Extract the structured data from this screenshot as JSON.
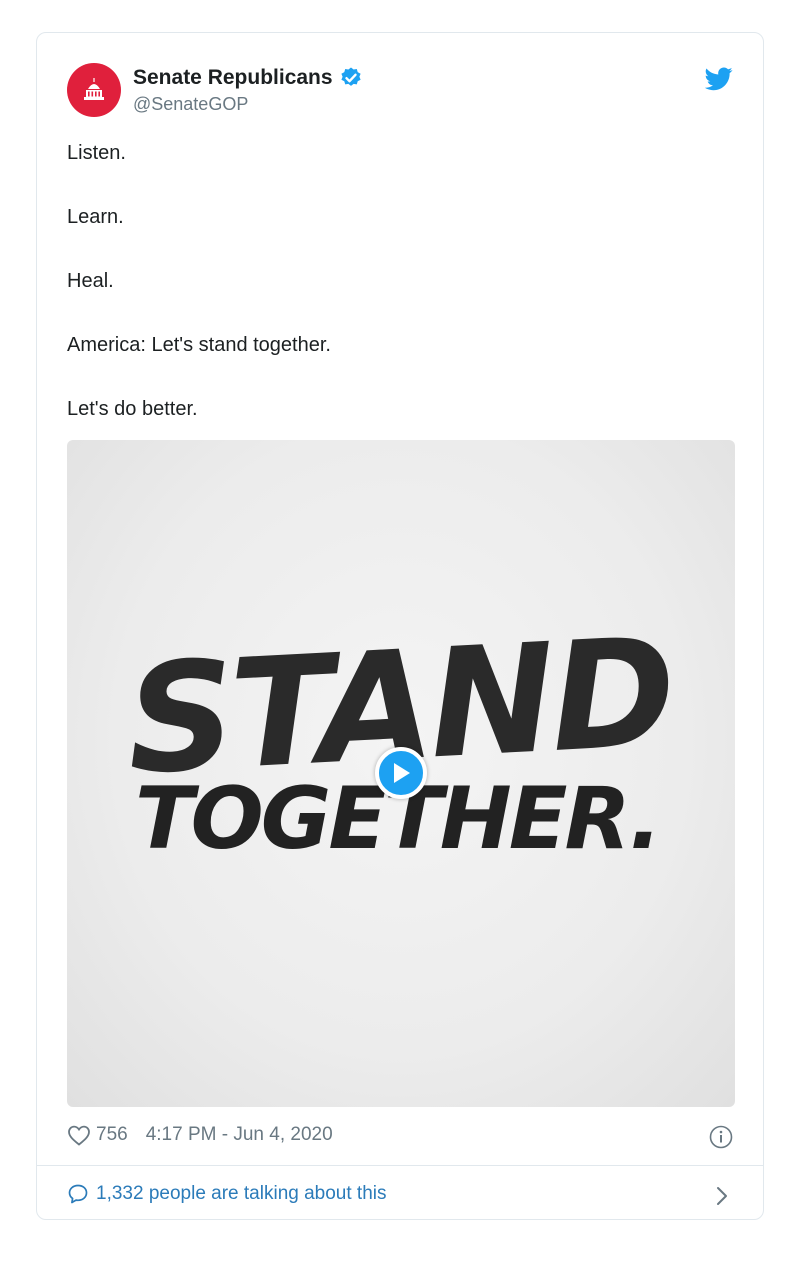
{
  "account": {
    "name": "Senate Republicans",
    "handle": "@SenateGOP",
    "avatar_color": "#e0203c",
    "verified": true
  },
  "tweet": {
    "lines": [
      "Listen.",
      "Learn.",
      "Heal.",
      "America: Let's stand together.",
      "Let's do better."
    ]
  },
  "media": {
    "type": "video",
    "art_text": [
      "STAND",
      "TOGETHER."
    ],
    "play_icon": "play-icon"
  },
  "footer": {
    "likes": "756",
    "timestamp": "4:17 PM - Jun 4, 2020",
    "talking": "1,332 people are talking about this"
  },
  "colors": {
    "accent": "#1da1f2",
    "link": "#2b7bb9",
    "muted": "#697882",
    "border": "#e1e8ed"
  }
}
